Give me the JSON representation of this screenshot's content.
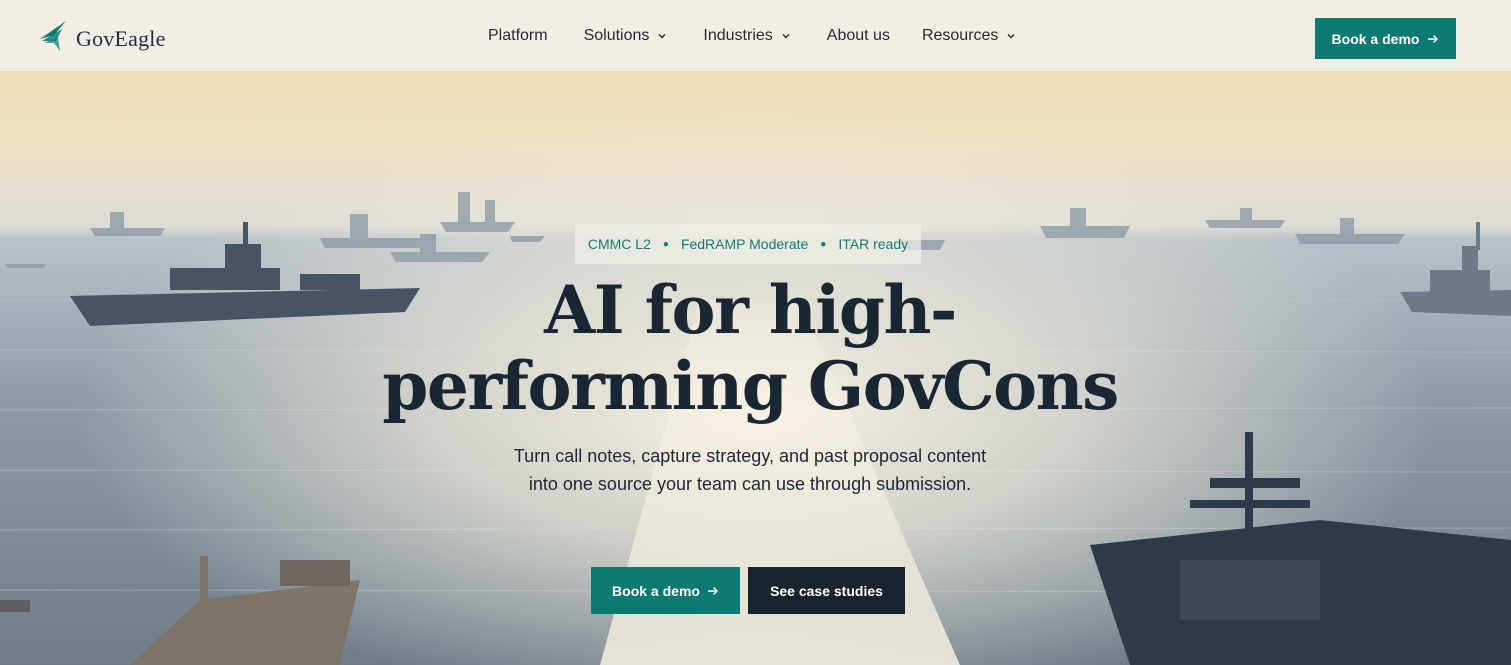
{
  "brand": {
    "name": "GovEagle",
    "accent_color": "#0c7a73",
    "dark_color": "#17232d",
    "logo_icon": "eagle-wing-logo"
  },
  "nav": {
    "items": [
      {
        "label": "Platform",
        "has_dropdown": false
      },
      {
        "label": "Solutions",
        "has_dropdown": true
      },
      {
        "label": "Industries",
        "has_dropdown": true
      },
      {
        "label": "About us",
        "has_dropdown": false
      },
      {
        "label": "Resources",
        "has_dropdown": true
      }
    ],
    "cta_label": "Book a demo",
    "cta_icon": "arrow-right-icon"
  },
  "hero": {
    "badges": [
      "CMMC L2",
      "FedRAMP Moderate",
      "ITAR ready"
    ],
    "headline_line1": "AI for high-",
    "headline_line2": "performing GovCons",
    "subtext": "Turn call notes, capture strategy, and past proposal content into one source your team can use through submission.",
    "primary_cta": "Book a demo",
    "secondary_cta": "See case studies",
    "background": "naval-fleet-at-sea-photo"
  }
}
